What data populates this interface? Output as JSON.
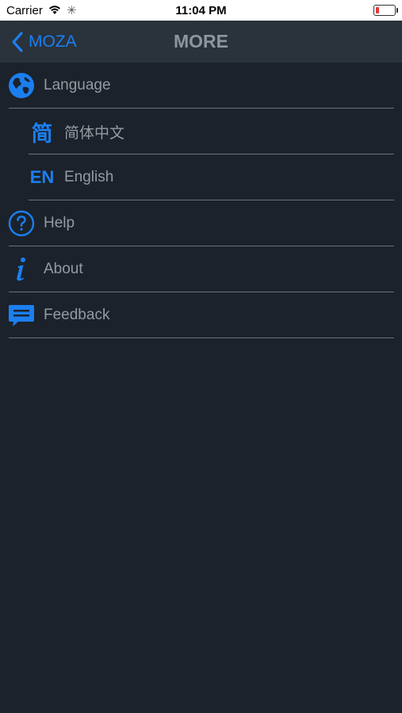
{
  "status_bar": {
    "carrier": "Carrier",
    "time": "11:04 PM",
    "battery_color": "#e53935"
  },
  "nav": {
    "back_label": "MOZA",
    "title": "MORE",
    "accent_color": "#1b7ff0"
  },
  "menu": {
    "items": [
      {
        "label": "Language",
        "icon": "globe-icon"
      },
      {
        "label": "简体中文",
        "icon_text": "简",
        "icon": "chinese-char-icon"
      },
      {
        "label": "English",
        "icon_text": "EN",
        "icon": "en-text-icon"
      },
      {
        "label": "Help",
        "icon": "question-circle-icon"
      },
      {
        "label": "About",
        "icon": "info-icon"
      },
      {
        "label": "Feedback",
        "icon": "chat-bubble-icon"
      }
    ]
  }
}
